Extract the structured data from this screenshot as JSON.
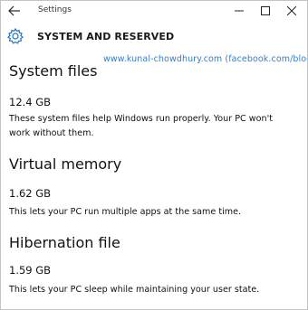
{
  "window": {
    "title": "Settings"
  },
  "header": {
    "title": "SYSTEM AND RESERVED",
    "icon": "gear-icon"
  },
  "watermark": "www.kunal-chowdhury.com (facebook.com/blog.kunal)",
  "sections": [
    {
      "title": "System files",
      "size": "12.4 GB",
      "description": "These system files help Windows run properly. Your PC won't work without them."
    },
    {
      "title": "Virtual memory",
      "size": "1.62 GB",
      "description": "This lets your PC run multiple apps at the same time."
    },
    {
      "title": "Hibernation file",
      "size": "1.59 GB",
      "description": "This lets your PC sleep while maintaining your user state."
    }
  ],
  "colors": {
    "accent": "#2f7fd0",
    "border": "#c4c4c4"
  }
}
